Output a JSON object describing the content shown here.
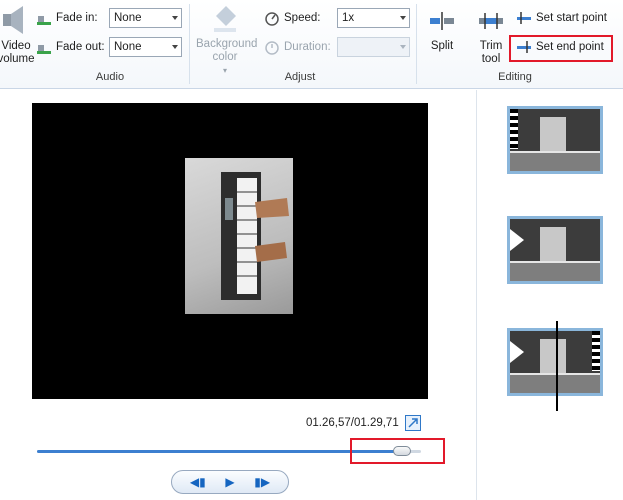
{
  "ribbon": {
    "audio": {
      "video_volume_label": "Video volume",
      "fade_in_label": "Fade in:",
      "fade_in_value": "None",
      "fade_out_label": "Fade out:",
      "fade_out_value": "None",
      "group_label": "Audio"
    },
    "adjust": {
      "background_color_label": "Background color",
      "speed_label": "Speed:",
      "speed_value": "1x",
      "duration_label": "Duration:",
      "duration_value": "",
      "group_label": "Adjust"
    },
    "editing": {
      "split_label": "Split",
      "trim_tool_label": "Trim tool",
      "set_start_point_label": "Set start point",
      "set_end_point_label": "Set end point",
      "group_label": "Editing"
    }
  },
  "preview": {
    "time_text": "01.26,57/01.29,71",
    "progress": 0.95
  },
  "colors": {
    "accent": "#3c7fd0",
    "highlight_box": "#e2192a",
    "clip_border": "#8ab6db"
  },
  "icons": {
    "video_volume": "speaker-icon",
    "fade_in": "fade-in-icon",
    "fade_out": "fade-out-icon",
    "background_color": "paint-bucket-icon",
    "speed": "speedometer-icon",
    "duration": "stopwatch-icon",
    "split": "split-icon",
    "trim_tool": "trim-icon",
    "set_start_point": "set-start-icon",
    "set_end_point": "set-end-icon",
    "expand": "expand-icon",
    "prev_frame": "previous-frame-icon",
    "play": "play-icon",
    "next_frame": "next-frame-icon"
  }
}
